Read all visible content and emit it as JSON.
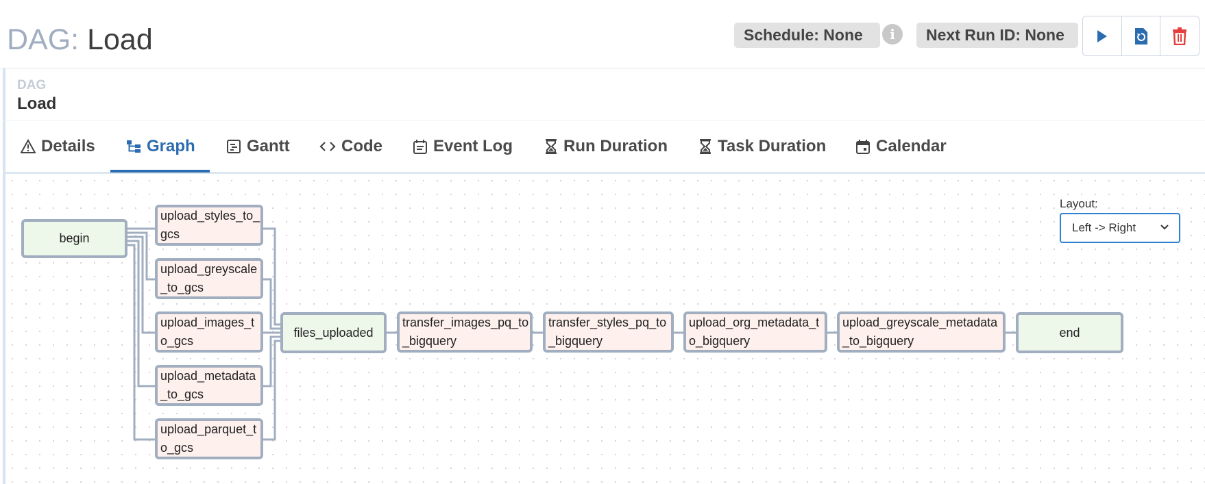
{
  "header": {
    "dag_prefix": "DAG:",
    "dag_name": "Load",
    "schedule": "Schedule: None",
    "next_run": "Next Run ID: None",
    "info_icon": "i",
    "actions": [
      "play-icon",
      "refresh-icon",
      "trash-icon"
    ]
  },
  "breadcrumb": {
    "small": "DAG",
    "big": "Load"
  },
  "tabs": [
    {
      "label": "Details",
      "icon": "warning-triangle-icon"
    },
    {
      "label": "Graph",
      "icon": "graph-icon",
      "active": true
    },
    {
      "label": "Gantt",
      "icon": "gantt-icon"
    },
    {
      "label": "Code",
      "icon": "code-icon"
    },
    {
      "label": "Event Log",
      "icon": "calendar-list-icon"
    },
    {
      "label": "Run Duration",
      "icon": "hourglass-icon"
    },
    {
      "label": "Task Duration",
      "icon": "hourglass-icon"
    },
    {
      "label": "Calendar",
      "icon": "calendar-icon"
    }
  ],
  "layout": {
    "label": "Layout:",
    "value": "Left -> Right"
  },
  "nodes": {
    "begin": "begin",
    "upload_styles_to_gcs": "upload_styles_to_gcs",
    "upload_greyscale_to_gcs": "upload_greyscale_to_gcs",
    "upload_images_to_gcs": "upload_images_to_gcs",
    "upload_metadata_to_gcs": "upload_metadata_to_gcs",
    "upload_parquet_to_gcs": "upload_parquet_to_gcs",
    "files_uploaded": "files_uploaded",
    "transfer_images_pq_to_bigquery": "transfer_images_pq_to_bigquery",
    "transfer_styles_pq_to_bigquery": "transfer_styles_pq_to_bigquery",
    "upload_org_metadata_to_bigquery": "upload_org_metadata_to_bigquery",
    "upload_greyscale_metadata_to_bigquery": "upload_greyscale_metadata_to_bigquery",
    "end": "end"
  },
  "colors": {
    "accent": "#2b6cb0",
    "success_node": "#edf7ea",
    "pending_node": "#fdf0ed",
    "node_border": "#a0aec0"
  }
}
